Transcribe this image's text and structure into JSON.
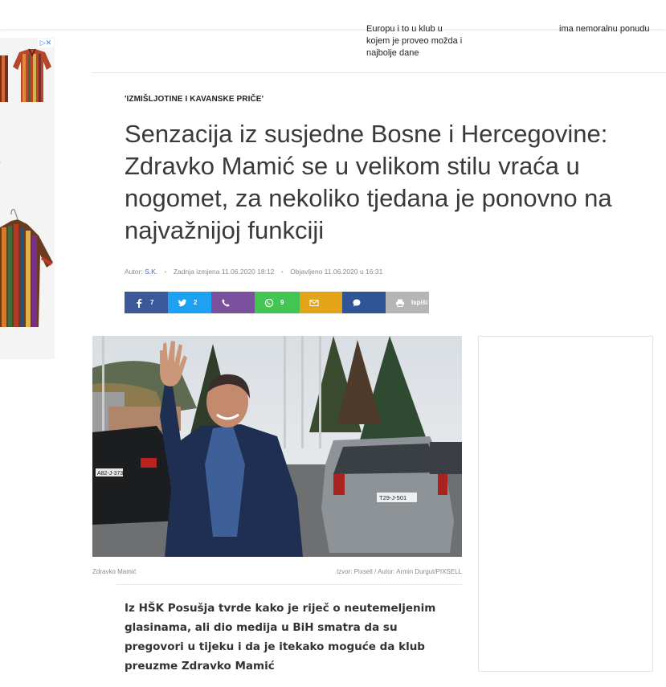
{
  "related": {
    "item1_text": "Europu i to u klub u kojem je proveo možda i najbolje dane",
    "item2_text": "ima nemoralnu ponudu"
  },
  "ad": {
    "close_label": "▷✕",
    "brand_colors": [
      "#c0392b",
      "#e67e22",
      "#2c6e49",
      "#8e44ad"
    ]
  },
  "article": {
    "kicker": "'IZMIŠLJOTINE I KAVANSKE PRIČE'",
    "headline": "Senzacija iz susjedne Bosne i Hercegovine: Zdravko Mamić se u velikom stilu vraća u nogomet, za nekoliko tjedana je ponovno na najvažnijoj funkciji",
    "meta": {
      "author_label": "Autor:",
      "author": "S.K.",
      "modified": "Zadnja izmjena 11.06.2020 18:12",
      "published": "Objavljeno 11.06.2020 u 16:31"
    },
    "share": {
      "facebook_count": "7",
      "twitter_count": "2",
      "viber_count": "",
      "whatsapp_count": "9",
      "email_count": "",
      "comment_count": "",
      "print_label": "Ispiši",
      "colors": {
        "facebook": "#3b5998",
        "twitter": "#1da1f2",
        "viber": "#7b519d",
        "whatsapp": "#43c553",
        "email": "#e3a41a",
        "comment": "#2f5597",
        "print": "#b5b5b5"
      }
    },
    "photo": {
      "caption": "Zdravko Mamić",
      "credit": "Izvor: Pixsell / Autor: Armin Durgut/PIXSELL",
      "plate_left": "A82-J-373",
      "plate_right": "T29-J-501"
    },
    "lead": "Iz HŠK Posušja tvrde kako je riječ o neutemeljenim glasinama, ali dio medija u BiH smatra da su pregovori u tijeku i da je itekako moguće da klub preuzme Zdravko Mamić"
  }
}
